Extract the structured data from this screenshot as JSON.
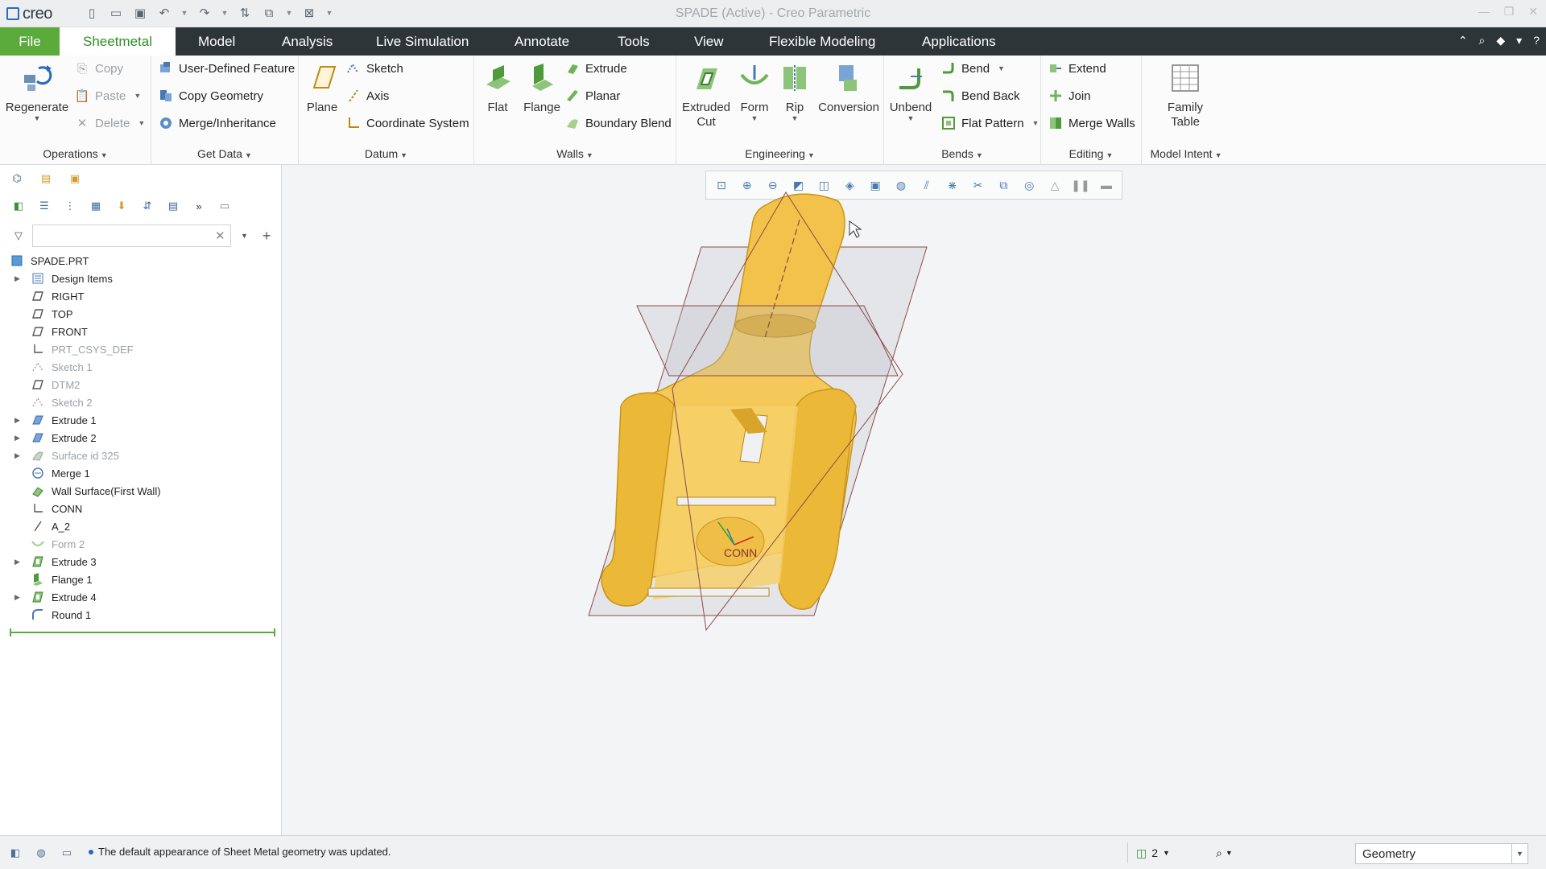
{
  "window": {
    "title": "SPADE (Active) - Creo Parametric",
    "logo": "creo"
  },
  "menubar": {
    "file": "File",
    "tabs": [
      "Sheetmetal",
      "Model",
      "Analysis",
      "Live Simulation",
      "Annotate",
      "Tools",
      "View",
      "Flexible Modeling",
      "Applications"
    ]
  },
  "ribbon": {
    "operations": {
      "label": "Operations",
      "regenerate": "Regenerate",
      "copy": "Copy",
      "paste": "Paste",
      "delete": "Delete"
    },
    "get_data": {
      "label": "Get Data",
      "udf": "User-Defined Feature",
      "copy_geometry": "Copy Geometry",
      "merge": "Merge/Inheritance"
    },
    "datum": {
      "label": "Datum",
      "plane": "Plane",
      "sketch": "Sketch",
      "axis": "Axis",
      "csys": "Coordinate System"
    },
    "walls": {
      "label": "Walls",
      "flat": "Flat",
      "flange": "Flange",
      "extrude": "Extrude",
      "planar": "Planar",
      "boundary_blend": "Boundary Blend"
    },
    "engineering": {
      "label": "Engineering",
      "extruded": "Extruded",
      "cut": "Cut",
      "form": "Form",
      "rip": "Rip",
      "conversion": "Conversion"
    },
    "bends": {
      "label": "Bends",
      "unbend": "Unbend",
      "bend": "Bend",
      "bend_back": "Bend Back",
      "flat_pattern": "Flat Pattern"
    },
    "editing": {
      "label": "Editing",
      "extend": "Extend",
      "join": "Join",
      "merge_walls": "Merge Walls"
    },
    "model_intent": {
      "label": "Model Intent",
      "family": "Family",
      "table": "Table"
    }
  },
  "tree": {
    "root": "SPADE.PRT",
    "items": [
      {
        "label": "Design Items",
        "expand": true,
        "dim": false,
        "icon": "design-items-icon"
      },
      {
        "label": "RIGHT",
        "expand": false,
        "dim": false,
        "icon": "datum-plane-icon"
      },
      {
        "label": "TOP",
        "expand": false,
        "dim": false,
        "icon": "datum-plane-icon"
      },
      {
        "label": "FRONT",
        "expand": false,
        "dim": false,
        "icon": "datum-plane-icon"
      },
      {
        "label": "PRT_CSYS_DEF",
        "expand": false,
        "dim": true,
        "icon": "csys-icon"
      },
      {
        "label": "Sketch 1",
        "expand": false,
        "dim": true,
        "icon": "sketch-icon"
      },
      {
        "label": "DTM2",
        "expand": false,
        "dim": true,
        "icon": "datum-plane-icon"
      },
      {
        "label": "Sketch 2",
        "expand": false,
        "dim": true,
        "icon": "sketch-icon"
      },
      {
        "label": "Extrude 1",
        "expand": true,
        "dim": false,
        "icon": "extrude-icon"
      },
      {
        "label": "Extrude 2",
        "expand": true,
        "dim": false,
        "icon": "extrude-icon"
      },
      {
        "label": "Surface id 325",
        "expand": true,
        "dim": true,
        "icon": "surface-icon"
      },
      {
        "label": "Merge 1",
        "expand": false,
        "dim": false,
        "icon": "merge-icon"
      },
      {
        "label": "Wall Surface(First Wall)",
        "expand": false,
        "dim": false,
        "icon": "wall-icon"
      },
      {
        "label": "CONN",
        "expand": false,
        "dim": false,
        "icon": "csys-icon"
      },
      {
        "label": "A_2",
        "expand": false,
        "dim": false,
        "icon": "axis-icon"
      },
      {
        "label": "Form 2",
        "expand": false,
        "dim": true,
        "icon": "form-icon"
      },
      {
        "label": "Extrude 3",
        "expand": true,
        "dim": false,
        "icon": "extrude-cut-icon"
      },
      {
        "label": "Flange 1",
        "expand": false,
        "dim": false,
        "icon": "flange-icon"
      },
      {
        "label": "Extrude 4",
        "expand": true,
        "dim": false,
        "icon": "extrude-cut-icon"
      },
      {
        "label": "Round 1",
        "expand": false,
        "dim": false,
        "icon": "round-icon"
      }
    ]
  },
  "viewport": {
    "csys_label": "CONN"
  },
  "status": {
    "message": "The default appearance of Sheet Metal geometry was updated.",
    "layer_count": "2",
    "selection_filter": "Geometry"
  },
  "colors": {
    "file_tab": "#5aaa3c",
    "menubar": "#2e3538",
    "active_tab_text": "#2e8f22",
    "model": "#f2c24b"
  }
}
